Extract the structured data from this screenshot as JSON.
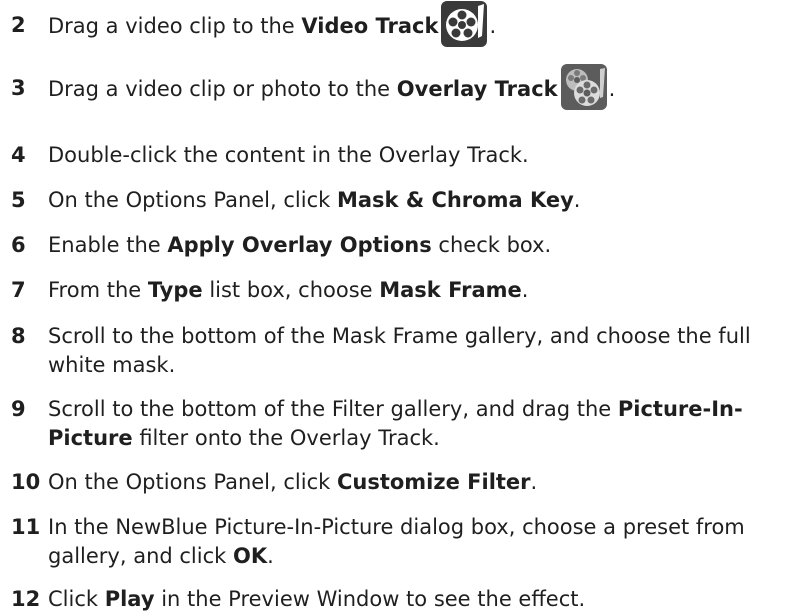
{
  "steps": [
    {
      "number": "2",
      "parts": [
        {
          "t": "Drag a video clip to the "
        },
        {
          "t": "Video Track",
          "b": true
        },
        {
          "icon": "video-track-icon"
        },
        {
          "t": "."
        }
      ]
    },
    {
      "number": "3",
      "parts": [
        {
          "t": "Drag a video clip or photo to the "
        },
        {
          "t": "Overlay Track",
          "b": true
        },
        {
          "icon": "overlay-track-icon"
        },
        {
          "t": "."
        }
      ]
    },
    {
      "number": "4",
      "parts": [
        {
          "t": "Double-click the content in the Overlay Track."
        }
      ]
    },
    {
      "number": "5",
      "parts": [
        {
          "t": "On the Options Panel, click "
        },
        {
          "t": "Mask & Chroma Key",
          "b": true
        },
        {
          "t": "."
        }
      ]
    },
    {
      "number": "6",
      "parts": [
        {
          "t": "Enable the "
        },
        {
          "t": "Apply Overlay Options",
          "b": true
        },
        {
          "t": " check box."
        }
      ]
    },
    {
      "number": "7",
      "parts": [
        {
          "t": "From the "
        },
        {
          "t": "Type",
          "b": true
        },
        {
          "t": " list box, choose "
        },
        {
          "t": "Mask Frame",
          "b": true
        },
        {
          "t": "."
        }
      ]
    },
    {
      "number": "8",
      "parts": [
        {
          "t": "Scroll to the bottom of the Mask Frame gallery, and choose the full"
        },
        {
          "br": true
        },
        {
          "t": "white mask."
        }
      ]
    },
    {
      "number": "9",
      "parts": [
        {
          "t": "Scroll to the bottom of the Filter gallery, and drag the "
        },
        {
          "t": "Picture-In-",
          "b": true
        },
        {
          "br": true
        },
        {
          "t": "Picture",
          "b": true
        },
        {
          "t": " filter onto the Overlay Track."
        }
      ]
    },
    {
      "number": "10",
      "parts": [
        {
          "t": "On the Options Panel, click "
        },
        {
          "t": "Customize Filter",
          "b": true
        },
        {
          "t": "."
        }
      ]
    },
    {
      "number": "11",
      "parts": [
        {
          "t": "In the NewBlue Picture-In-Picture dialog box, choose a preset from"
        },
        {
          "br": true
        },
        {
          "t": "gallery, and click "
        },
        {
          "t": "OK",
          "b": true
        },
        {
          "t": "."
        }
      ]
    },
    {
      "number": "12",
      "parts": [
        {
          "t": "Click "
        },
        {
          "t": "Play",
          "b": true
        },
        {
          "t": " in the Preview Window to see the effect."
        }
      ]
    }
  ]
}
